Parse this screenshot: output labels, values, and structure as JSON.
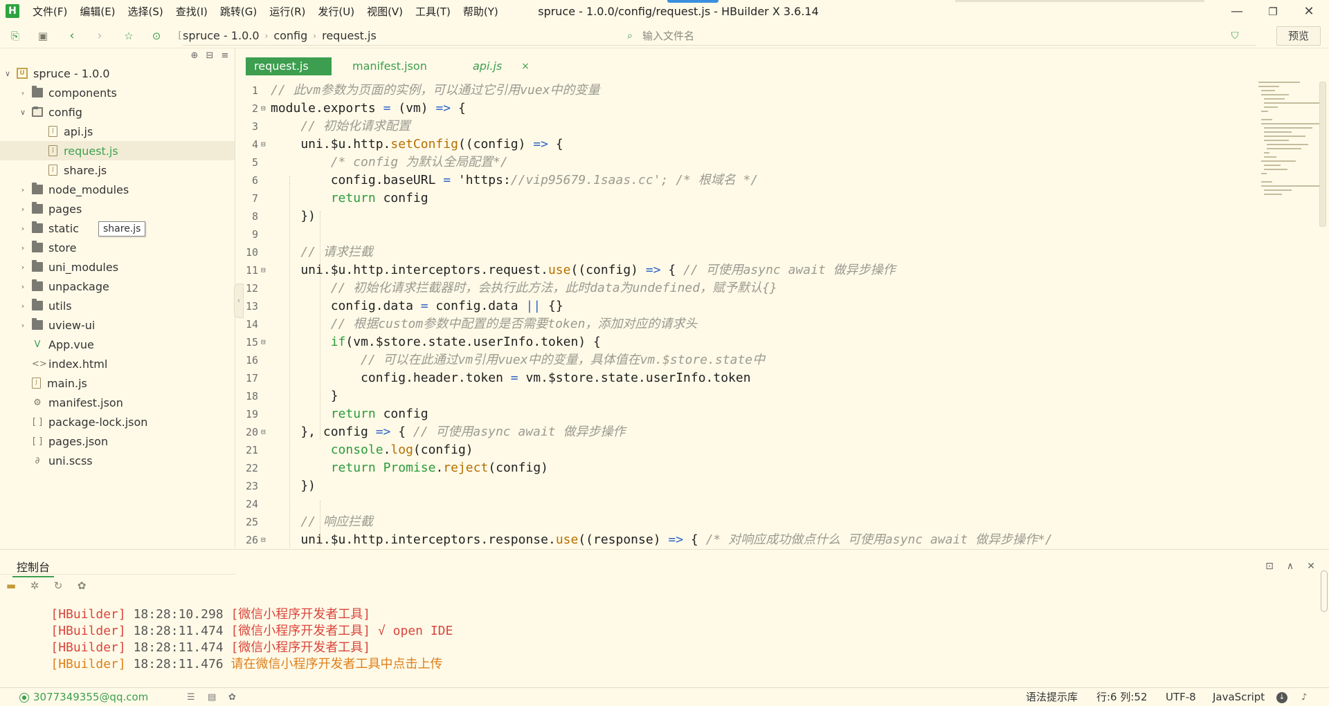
{
  "app": {
    "logo": "H",
    "window_title": "spruce - 1.0.0/config/request.js - HBuilder X 3.6.14",
    "menu": [
      "文件(F)",
      "编辑(E)",
      "选择(S)",
      "查找(I)",
      "跳转(G)",
      "运行(R)",
      "发行(U)",
      "视图(V)",
      "工具(T)",
      "帮助(Y)"
    ],
    "window_buttons": {
      "minimize": "—",
      "maximize": "❐",
      "close": "✕"
    }
  },
  "toolbar": {
    "breadcrumb": [
      "spruce - 1.0.0",
      "config",
      "request.js"
    ],
    "file_search_placeholder": "输入文件名",
    "preview_label": "预览"
  },
  "sidebar": {
    "project": "spruce - 1.0.0",
    "items": [
      {
        "label": "components",
        "type": "folder",
        "expanded": false
      },
      {
        "label": "config",
        "type": "folder",
        "expanded": true
      },
      {
        "label": "api.js",
        "type": "file"
      },
      {
        "label": "request.js",
        "type": "file",
        "selected": true
      },
      {
        "label": "share.js",
        "type": "file"
      },
      {
        "label": "node_modules",
        "type": "folder",
        "expanded": false
      },
      {
        "label": "pages",
        "type": "folder",
        "expanded": false
      },
      {
        "label": "static",
        "type": "folder",
        "expanded": false
      },
      {
        "label": "store",
        "type": "folder",
        "expanded": false
      },
      {
        "label": "uni_modules",
        "type": "folder",
        "expanded": false
      },
      {
        "label": "unpackage",
        "type": "folder",
        "expanded": false
      },
      {
        "label": "utils",
        "type": "folder",
        "expanded": false
      },
      {
        "label": "uview-ui",
        "type": "folder",
        "expanded": false
      },
      {
        "label": "App.vue",
        "type": "file"
      },
      {
        "label": "index.html",
        "type": "file"
      },
      {
        "label": "main.js",
        "type": "file"
      },
      {
        "label": "manifest.json",
        "type": "file"
      },
      {
        "label": "package-lock.json",
        "type": "file"
      },
      {
        "label": "pages.json",
        "type": "file"
      },
      {
        "label": "uni.scss",
        "type": "file"
      }
    ],
    "tooltip": "share.js"
  },
  "tabs": [
    {
      "label": "request.js",
      "active": true
    },
    {
      "label": "manifest.json",
      "active": false
    },
    {
      "label": "api.js",
      "active": false,
      "close": "×"
    }
  ],
  "editor": {
    "line_numbers": [
      "1",
      "2",
      "3",
      "4",
      "5",
      "6",
      "7",
      "8",
      "9",
      "10",
      "11",
      "12",
      "13",
      "14",
      "15",
      "16",
      "17",
      "18",
      "19",
      "20",
      "21",
      "22",
      "23",
      "24",
      "25",
      "26"
    ],
    "lines": [
      "// 此vm参数为页面的实例，可以通过它引用vuex中的变量",
      "module.exports = (vm) => {",
      "    // 初始化请求配置",
      "    uni.$u.http.setConfig((config) => {",
      "        /* config 为默认全局配置*/",
      "        config.baseURL = 'https://vip95679.1saas.cc'; /* 根域名 */",
      "        return config",
      "    })",
      "",
      "    // 请求拦截",
      "    uni.$u.http.interceptors.request.use((config) => { // 可使用async await 做异步操作",
      "        // 初始化请求拦截器时，会执行此方法，此时data为undefined，赋予默认{}",
      "        config.data = config.data || {}",
      "        // 根据custom参数中配置的是否需要token，添加对应的请求头",
      "        if(vm.$store.state.userInfo.token) {",
      "            // 可以在此通过vm引用vuex中的变量，具体值在vm.$store.state中",
      "            config.header.token = vm.$store.state.userInfo.token",
      "        }",
      "        return config",
      "    }, config => { // 可使用async await 做异步操作",
      "        console.log(config)",
      "        return Promise.reject(config)",
      "    })",
      "",
      "    // 响应拦截",
      "    uni.$u.http.interceptors.response.use((response) => { /* 对响应成功做点什么 可使用async await 做异步操作*/"
    ]
  },
  "console": {
    "tab_label": "控制台",
    "logs": [
      {
        "tag": "[HBuilder]",
        "time": "18:28:10.298",
        "msg": "[微信小程序开发者工具]"
      },
      {
        "tag": "[HBuilder]",
        "time": "18:28:11.474",
        "msg": "[微信小程序开发者工具] √ open IDE"
      },
      {
        "tag": "[HBuilder]",
        "time": "18:28:11.474",
        "msg": "[微信小程序开发者工具]"
      },
      {
        "tag": "[HBuilder]",
        "time": "18:28:11.476",
        "msg": "请在微信小程序开发者工具中点击上传"
      }
    ]
  },
  "statusbar": {
    "user": "3077349355@qq.com",
    "syntax_hint": "语法提示库",
    "position": "行:6  列:52",
    "encoding": "UTF-8",
    "language": "JavaScript"
  },
  "colors": {
    "background": "#fffae8",
    "accent_green": "#3c9e4e",
    "log_red": "#d9453c",
    "log_orange": "#dd7f1a"
  },
  "icons": [
    "new-file-icon",
    "save-icon",
    "back-icon",
    "forward-icon",
    "bookmark-icon",
    "run-icon",
    "filter-icon",
    "locate-icon",
    "collapse-all-icon",
    "more-icon",
    "folder-icon",
    "file-icon",
    "debug-icon",
    "git-icon",
    "plugin-icon",
    "user-icon",
    "bell-icon"
  ]
}
